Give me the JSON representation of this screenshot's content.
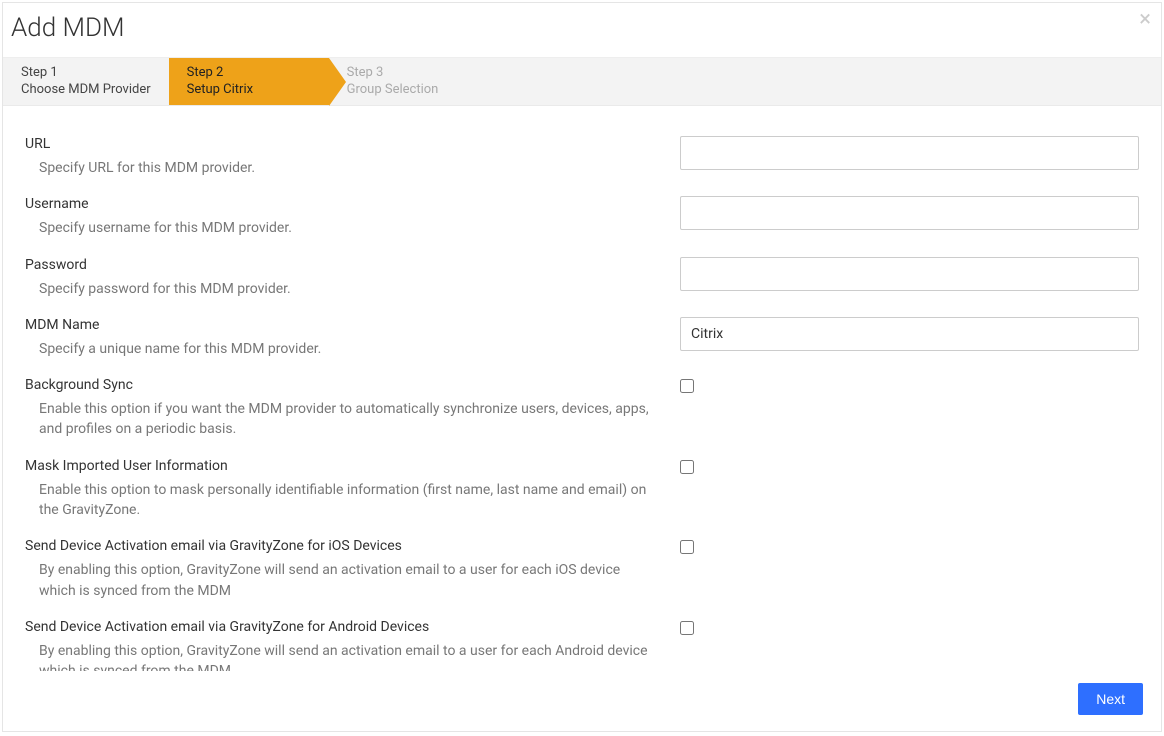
{
  "header": {
    "title": "Add MDM",
    "close_glyph": "×"
  },
  "stepper": {
    "steps": [
      {
        "num": "Step 1",
        "label": "Choose MDM Provider",
        "state": "past"
      },
      {
        "num": "Step 2",
        "label": "Setup Citrix",
        "state": "active"
      },
      {
        "num": "Step 3",
        "label": "Group Selection",
        "state": "future"
      }
    ]
  },
  "form": {
    "fields": [
      {
        "key": "url",
        "label": "URL",
        "desc": "Specify URL for this MDM provider.",
        "type": "text",
        "value": ""
      },
      {
        "key": "username",
        "label": "Username",
        "desc": "Specify username for this MDM provider.",
        "type": "text",
        "value": ""
      },
      {
        "key": "password",
        "label": "Password",
        "desc": "Specify password for this MDM provider.",
        "type": "password",
        "value": ""
      },
      {
        "key": "mdm_name",
        "label": "MDM Name",
        "desc": "Specify a unique name for this MDM provider.",
        "type": "text",
        "value": "Citrix"
      },
      {
        "key": "bg_sync",
        "label": "Background Sync",
        "desc": "Enable this option if you want the MDM provider to automatically synchronize users, devices, apps, and profiles on a periodic basis.",
        "type": "checkbox",
        "checked": false
      },
      {
        "key": "mask_user",
        "label": "Mask Imported User Information",
        "desc": "Enable this option to mask personally identifiable information (first name, last name and email) on the GravityZone.",
        "type": "checkbox",
        "checked": false
      },
      {
        "key": "act_ios",
        "label": "Send Device Activation email via GravityZone for iOS Devices",
        "desc": "By enabling this option, GravityZone will send an activation email to a user for each iOS device which is synced from the MDM",
        "type": "checkbox",
        "checked": false
      },
      {
        "key": "act_android",
        "label": "Send Device Activation email via GravityZone for Android Devices",
        "desc": "By enabling this option, GravityZone will send an activation email to a user for each Android device which is synced from the MDM",
        "type": "checkbox",
        "checked": false
      }
    ]
  },
  "footer": {
    "next_label": "Next"
  }
}
